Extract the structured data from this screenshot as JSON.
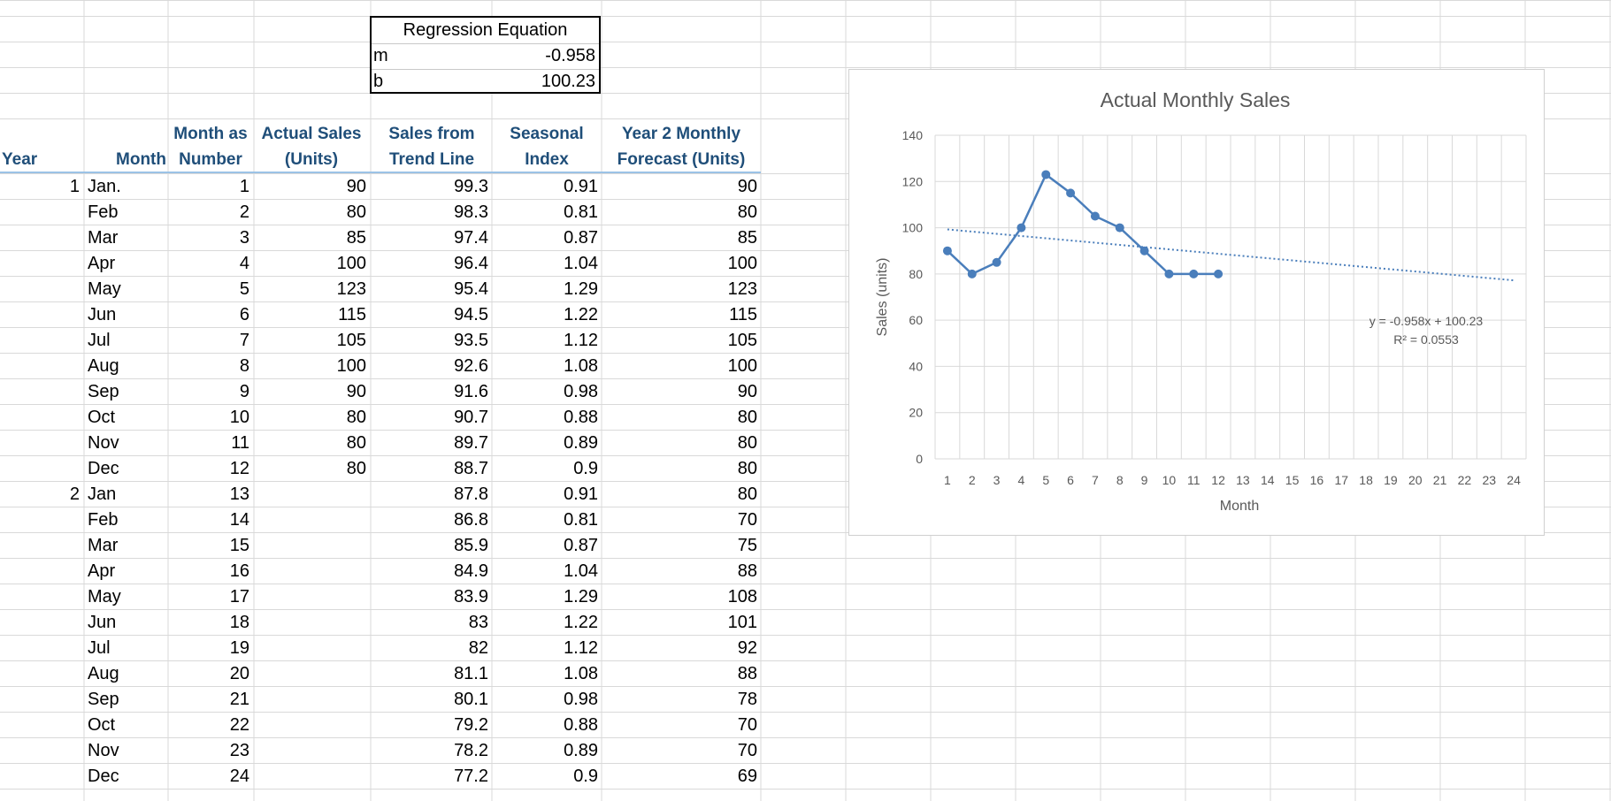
{
  "regression": {
    "title": "Regression Equation",
    "rows": [
      {
        "label": "m",
        "value": "-0.958"
      },
      {
        "label": "b",
        "value": "100.23"
      }
    ]
  },
  "table": {
    "headers": {
      "year": "Year",
      "month": "Month",
      "month_num": [
        "Month as",
        "Number"
      ],
      "actual": [
        "Actual Sales",
        "(Units)"
      ],
      "trend": [
        "Sales from",
        "Trend Line"
      ],
      "seasonal": [
        "Seasonal",
        "Index"
      ],
      "forecast": [
        "Year 2 Monthly",
        "Forecast (Units)"
      ]
    },
    "rows": [
      {
        "year": "1",
        "month": "Jan.",
        "num": "1",
        "actual": "90",
        "trend": "99.3",
        "seasonal": "0.91",
        "forecast": "90"
      },
      {
        "year": "",
        "month": "Feb",
        "num": "2",
        "actual": "80",
        "trend": "98.3",
        "seasonal": "0.81",
        "forecast": "80"
      },
      {
        "year": "",
        "month": "Mar",
        "num": "3",
        "actual": "85",
        "trend": "97.4",
        "seasonal": "0.87",
        "forecast": "85"
      },
      {
        "year": "",
        "month": "Apr",
        "num": "4",
        "actual": "100",
        "trend": "96.4",
        "seasonal": "1.04",
        "forecast": "100"
      },
      {
        "year": "",
        "month": "May",
        "num": "5",
        "actual": "123",
        "trend": "95.4",
        "seasonal": "1.29",
        "forecast": "123"
      },
      {
        "year": "",
        "month": "Jun",
        "num": "6",
        "actual": "115",
        "trend": "94.5",
        "seasonal": "1.22",
        "forecast": "115"
      },
      {
        "year": "",
        "month": "Jul",
        "num": "7",
        "actual": "105",
        "trend": "93.5",
        "seasonal": "1.12",
        "forecast": "105"
      },
      {
        "year": "",
        "month": "Aug",
        "num": "8",
        "actual": "100",
        "trend": "92.6",
        "seasonal": "1.08",
        "forecast": "100"
      },
      {
        "year": "",
        "month": "Sep",
        "num": "9",
        "actual": "90",
        "trend": "91.6",
        "seasonal": "0.98",
        "forecast": "90"
      },
      {
        "year": "",
        "month": "Oct",
        "num": "10",
        "actual": "80",
        "trend": "90.7",
        "seasonal": "0.88",
        "forecast": "80"
      },
      {
        "year": "",
        "month": "Nov",
        "num": "11",
        "actual": "80",
        "trend": "89.7",
        "seasonal": "0.89",
        "forecast": "80"
      },
      {
        "year": "",
        "month": "Dec",
        "num": "12",
        "actual": "80",
        "trend": "88.7",
        "seasonal": "0.9",
        "forecast": "80"
      },
      {
        "year": "2",
        "month": "Jan",
        "num": "13",
        "actual": "",
        "trend": "87.8",
        "seasonal": "0.91",
        "forecast": "80"
      },
      {
        "year": "",
        "month": "Feb",
        "num": "14",
        "actual": "",
        "trend": "86.8",
        "seasonal": "0.81",
        "forecast": "70"
      },
      {
        "year": "",
        "month": "Mar",
        "num": "15",
        "actual": "",
        "trend": "85.9",
        "seasonal": "0.87",
        "forecast": "75"
      },
      {
        "year": "",
        "month": "Apr",
        "num": "16",
        "actual": "",
        "trend": "84.9",
        "seasonal": "1.04",
        "forecast": "88"
      },
      {
        "year": "",
        "month": "May",
        "num": "17",
        "actual": "",
        "trend": "83.9",
        "seasonal": "1.29",
        "forecast": "108"
      },
      {
        "year": "",
        "month": "Jun",
        "num": "18",
        "actual": "",
        "trend": "83",
        "seasonal": "1.22",
        "forecast": "101"
      },
      {
        "year": "",
        "month": "Jul",
        "num": "19",
        "actual": "",
        "trend": "82",
        "seasonal": "1.12",
        "forecast": "92"
      },
      {
        "year": "",
        "month": "Aug",
        "num": "20",
        "actual": "",
        "trend": "81.1",
        "seasonal": "1.08",
        "forecast": "88"
      },
      {
        "year": "",
        "month": "Sep",
        "num": "21",
        "actual": "",
        "trend": "80.1",
        "seasonal": "0.98",
        "forecast": "78"
      },
      {
        "year": "",
        "month": "Oct",
        "num": "22",
        "actual": "",
        "trend": "79.2",
        "seasonal": "0.88",
        "forecast": "70"
      },
      {
        "year": "",
        "month": "Nov",
        "num": "23",
        "actual": "",
        "trend": "78.2",
        "seasonal": "0.89",
        "forecast": "70"
      },
      {
        "year": "",
        "month": "Dec",
        "num": "24",
        "actual": "",
        "trend": "77.2",
        "seasonal": "0.9",
        "forecast": "69"
      }
    ]
  },
  "chart_data": {
    "type": "scatter",
    "title": "Actual Monthly Sales",
    "xlabel": "Month",
    "ylabel": "Sales (units)",
    "xlim": [
      0.5,
      24.5
    ],
    "ylim": [
      0,
      140
    ],
    "x_ticks": [
      "1",
      "2",
      "3",
      "4",
      "5",
      "6",
      "7",
      "8",
      "9",
      "10",
      "11",
      "12",
      "13",
      "14",
      "15",
      "16",
      "17",
      "18",
      "19",
      "20",
      "21",
      "22",
      "23",
      "24"
    ],
    "y_ticks": [
      "0",
      "20",
      "40",
      "60",
      "80",
      "100",
      "120",
      "140"
    ],
    "grid": true,
    "series": [
      {
        "x": [
          1,
          2,
          3,
          4,
          5,
          6,
          7,
          8,
          9,
          10,
          11,
          12
        ],
        "values": [
          90,
          80,
          85,
          100,
          123,
          115,
          105,
          100,
          90,
          80,
          80,
          80
        ],
        "color": "#4a7ebb"
      }
    ],
    "trendline": {
      "slope": -0.958,
      "intercept": 100.23,
      "x_range": [
        1,
        24
      ],
      "color": "#4a7ebb"
    },
    "annotation_lines": [
      "y = -0.958x + 100.23",
      "R² = 0.0553"
    ]
  },
  "colors": {
    "header_text": "#1f4e79",
    "header_underline": "#9bc2e6",
    "grid_line": "#d9d9d9",
    "series": "#4a7ebb"
  }
}
